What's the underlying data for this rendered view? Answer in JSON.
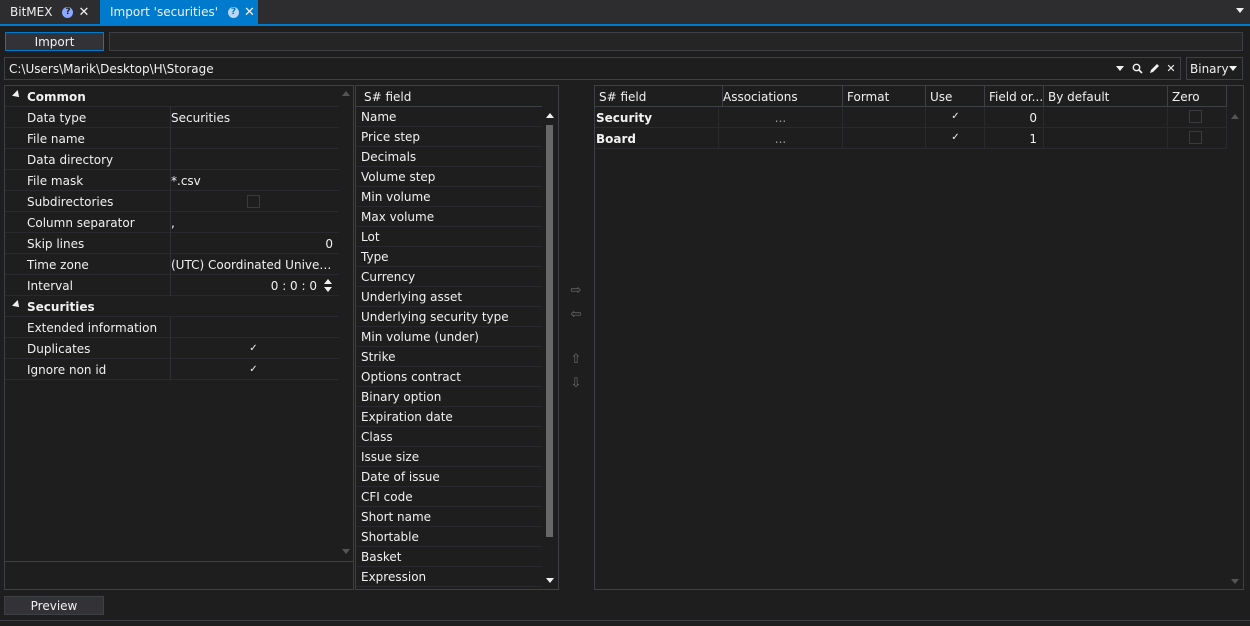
{
  "tabs": [
    {
      "label": "BitMEX"
    },
    {
      "label": "Import 'securities'"
    }
  ],
  "toolbar": {
    "import_label": "Import"
  },
  "path": {
    "value": "C:\\Users\\Marik\\Desktop\\H\\Storage"
  },
  "format": {
    "selected": "Binary"
  },
  "properties": {
    "common_label": "Common",
    "securities_label": "Securities",
    "rows": {
      "data_type": {
        "label": "Data type",
        "value": "Securities"
      },
      "file_name": {
        "label": "File name",
        "value": ""
      },
      "data_directory": {
        "label": "Data directory",
        "value": ""
      },
      "file_mask": {
        "label": "File mask",
        "value": "*.csv"
      },
      "subdirectories": {
        "label": "Subdirectories",
        "checked": false
      },
      "column_separator": {
        "label": "Column separator",
        "value": ","
      },
      "skip_lines": {
        "label": "Skip lines",
        "value": "0"
      },
      "time_zone": {
        "label": "Time zone",
        "value": "(UTC) Coordinated Universal Time"
      },
      "interval": {
        "label": "Interval",
        "value": "0 : 0 : 0"
      },
      "extended_information": {
        "label": "Extended information",
        "value": ""
      },
      "duplicates": {
        "label": "Duplicates",
        "checked": true
      },
      "ignore_non_id": {
        "label": "Ignore non id",
        "checked": true
      }
    }
  },
  "fields": {
    "header": "S# field",
    "items": [
      "Name",
      "Price step",
      "Decimals",
      "Volume step",
      "Min volume",
      "Max volume",
      "Lot",
      "Type",
      "Currency",
      "Underlying asset",
      "Underlying security type",
      "Min volume (under)",
      "Strike",
      "Options contract",
      "Binary option",
      "Expiration date",
      "Class",
      "Issue size",
      "Date of issue",
      "CFI code",
      "Short name",
      "Shortable",
      "Basket",
      "Expression"
    ]
  },
  "mapping": {
    "columns": [
      "S# field",
      "Associations",
      "Format",
      "Use",
      "Field or...",
      "By default",
      "Zero"
    ],
    "rows": [
      {
        "field": "Security",
        "associations": "...",
        "format": "",
        "use": true,
        "order": "0",
        "default": "",
        "zero": false
      },
      {
        "field": "Board",
        "associations": "...",
        "format": "",
        "use": true,
        "order": "1",
        "default": "",
        "zero": false
      }
    ]
  },
  "preview_label": "Preview",
  "icons": {
    "tab_help": "help-icon",
    "tab_close": "close-icon",
    "path_search": "search-icon",
    "path_edit": "pencil-icon",
    "path_clear": "close-icon",
    "move_right": "arrow-right-icon",
    "move_left": "arrow-left-icon",
    "move_up": "arrow-up-icon",
    "move_down": "arrow-down-icon"
  },
  "colors": {
    "accent": "#007acc",
    "background": "#1e1e1e",
    "text": "#f1f1f1"
  }
}
